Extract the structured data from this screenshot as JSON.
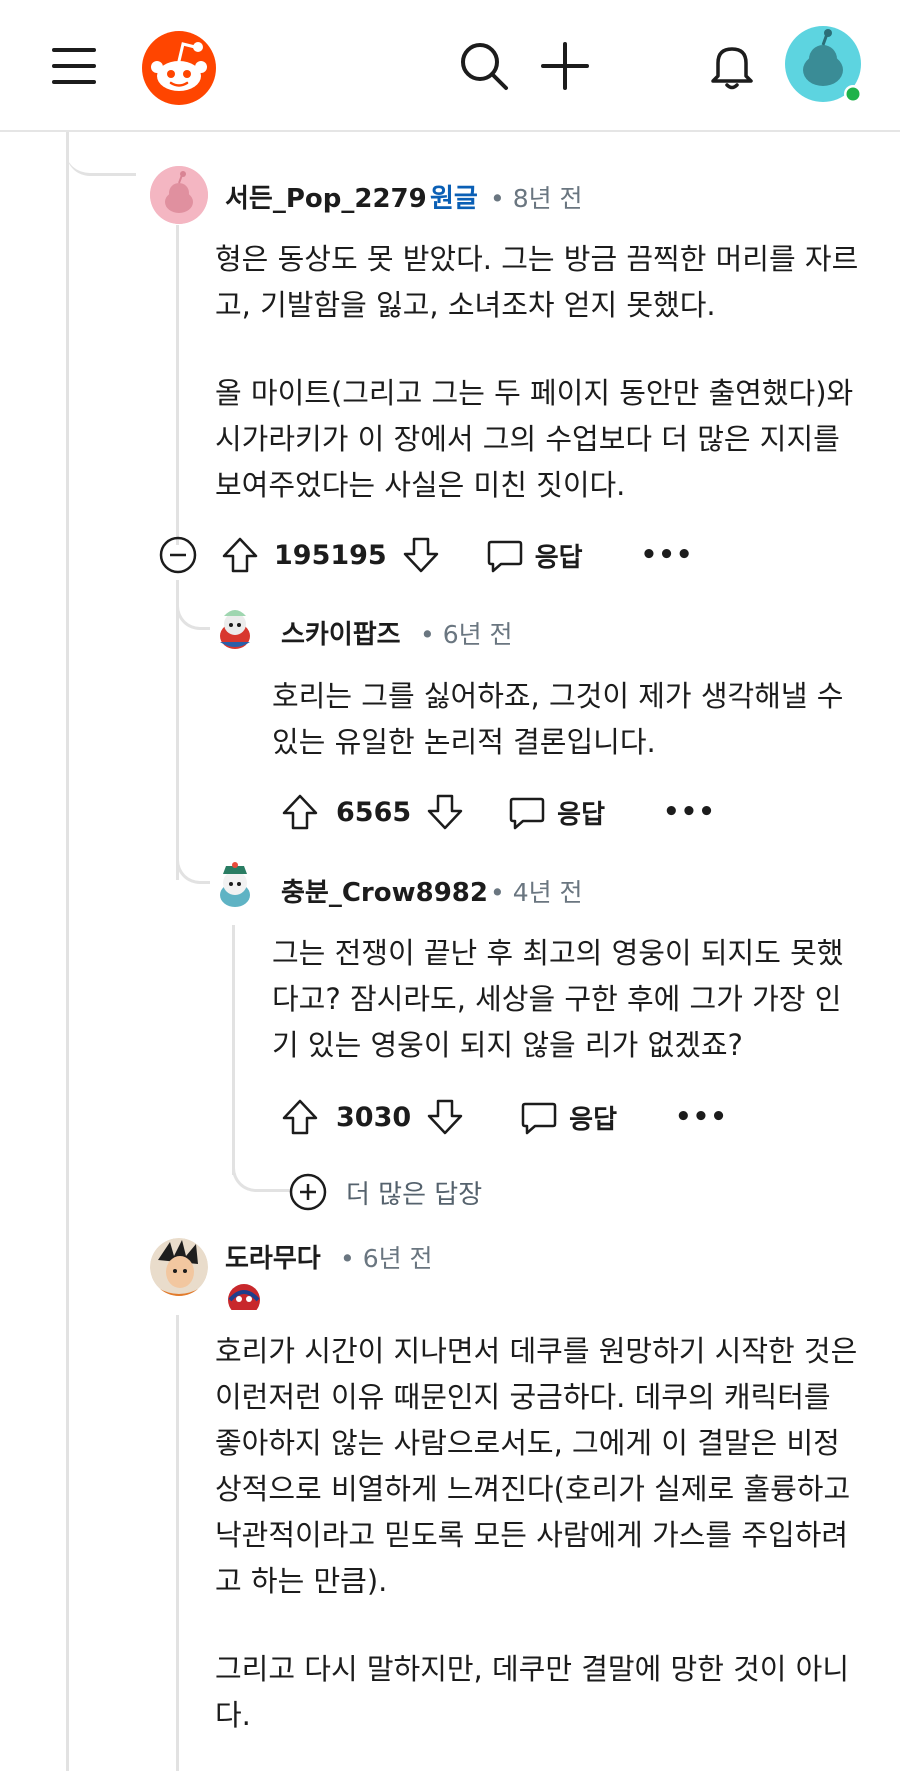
{
  "header": {
    "menu_icon": "hamburger-icon",
    "logo_icon": "reddit-snoo-logo",
    "search_icon": "search-icon",
    "create_icon": "plus-icon",
    "notifications_icon": "bell-icon",
    "profile_icon": "avatar-icon",
    "online_color": "#1fb24a"
  },
  "comments": [
    {
      "username": "서든_Pop_2279",
      "op_label": "원글",
      "time": "• 8년 전",
      "body": [
        "형은 동상도 못 받았다. 그는 방금 끔찍한 머리를 자르고, 기발함을 잃고, 소녀조차 얻지 못했다.",
        "올 마이트(그리고 그는 두 페이지 동안만 출연했다)와 시가라키가 이 장에서 그의 수업보다 더 많은 지지를 보여주었다는 사실은 미친 짓이다."
      ],
      "votes": "195195",
      "reply_label": "응답",
      "more_label": "•••"
    },
    {
      "username": "스카이팝즈",
      "time": "• 6년 전",
      "body": [
        "호리는 그를 싫어하죠, 그것이 제가 생각해낼 수 있는 유일한 논리적 결론입니다."
      ],
      "votes": "6565",
      "reply_label": "응답",
      "more_label": "•••"
    },
    {
      "username": "충분_Crow8982",
      "time": "• 4년 전",
      "body": [
        "그는 전쟁이 끝난 후 최고의 영웅이 되지도 못했다고? 잠시라도, 세상을 구한 후에 그가 가장 인기 있는 영웅이 되지 않을 리가 없겠죠?"
      ],
      "votes": "3030",
      "reply_label": "응답",
      "more_label": "•••"
    },
    {
      "username": "도라무다",
      "time": "• 6년 전",
      "body": [
        "호리가 시간이 지나면서 데쿠를 원망하기 시작한 것은 이런저런 이유 때문인지 궁금하다. 데쿠의 캐릭터를 좋아하지 않는 사람으로서도, 그에게 이 결말은 비정상적으로 비열하게 느껴진다(호리가 실제로 훌륭하고 낙관적이라고 믿도록 모든 사람에게 가스를 주입하려고 하는 만큼).",
        "그리고 다시 말하지만, 데쿠만 결말에 망한 것이 아니다."
      ]
    }
  ],
  "more_replies_label": "더 많은 답장"
}
